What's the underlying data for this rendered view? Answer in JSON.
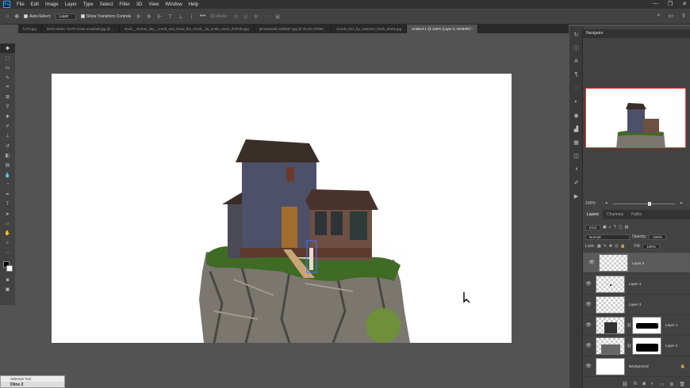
{
  "app": {
    "logo": "Ps"
  },
  "menu": [
    "File",
    "Edit",
    "Image",
    "Layer",
    "Type",
    "Select",
    "Filter",
    "3D",
    "View",
    "Window",
    "Help"
  ],
  "window_controls": [
    "—",
    "❐",
    "✕"
  ],
  "options": {
    "auto_select_label": "Auto-Select:",
    "auto_select_value": "Layer",
    "show_transform_label": "Show Transform Controls",
    "mode_3d_label": "3D Mode:"
  },
  "tabs": [
    {
      "label": "ful-hr.jpg",
      "active": false
    },
    {
      "label": "kristi-martin-~b17F-ezew-unsplash.jpg @ ...",
      "active": false
    },
    {
      "label": "stock__stormy_sky__credit_and_show_the_result__by_smbu_stock_d781rla.jpg",
      "active": false
    },
    {
      "label": "gimedesald-1338667.jpg @ 33.3% (RGB/...",
      "active": false
    },
    {
      "label": "clouds_014_by_ravlpoint_stock_drebe.jpg",
      "active": false
    },
    {
      "label": "Untitled-1 @ 100% (Layer 5, RGB/8#) *",
      "active": true
    }
  ],
  "navigator": {
    "title": "Navigator",
    "zoom": "100%"
  },
  "layers_panel": {
    "tabs": [
      "Layers",
      "Channels",
      "Paths"
    ],
    "kind_label": "Kind",
    "blend_mode": "Normal",
    "opacity_label": "Opacity:",
    "opacity_value": "100%",
    "lock_label": "Lock:",
    "fill_label": "Fill:",
    "fill_value": "100%",
    "layers": [
      {
        "name": "Layer 5",
        "selected": true,
        "mask": false,
        "thumb": "checker"
      },
      {
        "name": "Layer 4",
        "selected": false,
        "mask": false,
        "thumb": "checker"
      },
      {
        "name": "Layer 3",
        "selected": false,
        "mask": false,
        "thumb": "checker"
      },
      {
        "name": "Layer 1",
        "selected": false,
        "mask": true,
        "thumb": "house"
      },
      {
        "name": "Layer 2",
        "selected": false,
        "mask": true,
        "thumb": "rock"
      },
      {
        "name": "Background",
        "selected": false,
        "mask": false,
        "thumb": "white",
        "locked": true
      }
    ]
  },
  "float_panel": {
    "title": "Selection Tool",
    "label": "Dline 2"
  },
  "colors": {
    "accent": "#31a8ff",
    "nav_border": "#ff3b3b",
    "bg_dark": "#323232",
    "panel": "#424242",
    "canvas_bg": "#535353"
  }
}
